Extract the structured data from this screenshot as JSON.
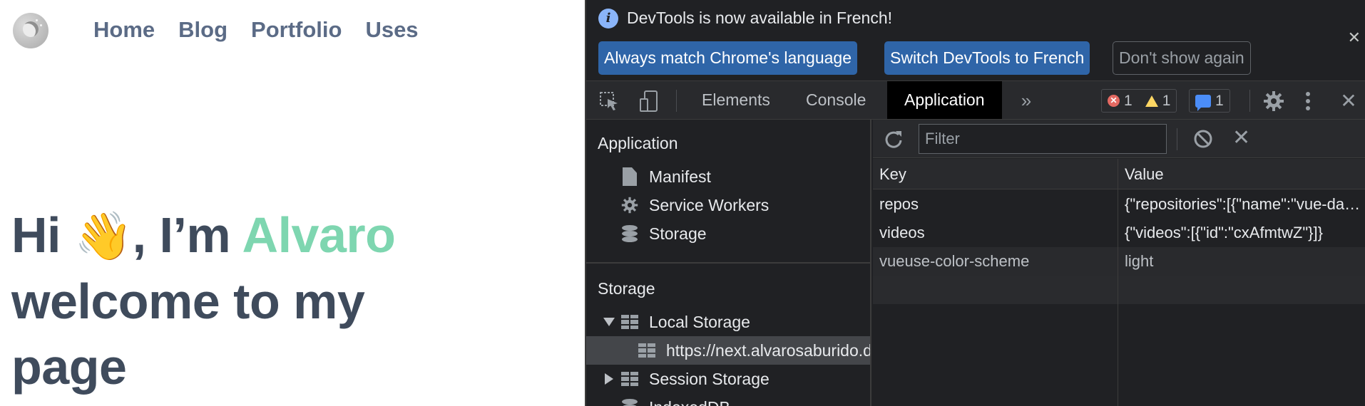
{
  "site": {
    "nav": [
      "Home",
      "Blog",
      "Portfolio",
      "Uses"
    ],
    "hero": {
      "greeting": "Hi",
      "wave_emoji": "👋",
      "middle": ", I’m",
      "name": "Alvaro",
      "line2": "welcome to my",
      "line3": "page"
    },
    "colors": {
      "nav": "#5b6b86",
      "heading": "#3f4b5c",
      "accent": "#7ed6b0"
    }
  },
  "devtools": {
    "infobar": {
      "message": "DevTools is now available in French!",
      "buttons": [
        "Always match Chrome's language",
        "Switch DevTools to French",
        "Don't show again"
      ],
      "close_icon": "✕"
    },
    "tabs": [
      "Elements",
      "Console",
      "Application"
    ],
    "active_tab": "Application",
    "more_tabs_icon": "»",
    "counts": {
      "errors": "1",
      "warnings": "1",
      "messages": "1"
    },
    "sidebar": {
      "application_header": "Application",
      "application_items": [
        "Manifest",
        "Service Workers",
        "Storage"
      ],
      "storage_header": "Storage",
      "local_storage": "Local Storage",
      "local_storage_origin": "https://next.alvarosaburido.dev",
      "session_storage": "Session Storage",
      "indexeddb": "IndexedDB"
    },
    "filter": {
      "placeholder": "Filter"
    },
    "table": {
      "columns": [
        "Key",
        "Value"
      ],
      "rows": [
        {
          "key": "repos",
          "value": "{\"repositories\":[{\"name\":\"vue-dark-mode\"}]}"
        },
        {
          "key": "videos",
          "value": "{\"videos\":[{\"id\":\"cxAfmtwZ\"}]}"
        },
        {
          "key": "vueuse-color-scheme",
          "value": "light"
        }
      ]
    },
    "colors": {
      "background": "#202124",
      "toolbar": "#292a2d",
      "primary_button": "#2f65a8",
      "selected_row": "#44464a"
    }
  }
}
